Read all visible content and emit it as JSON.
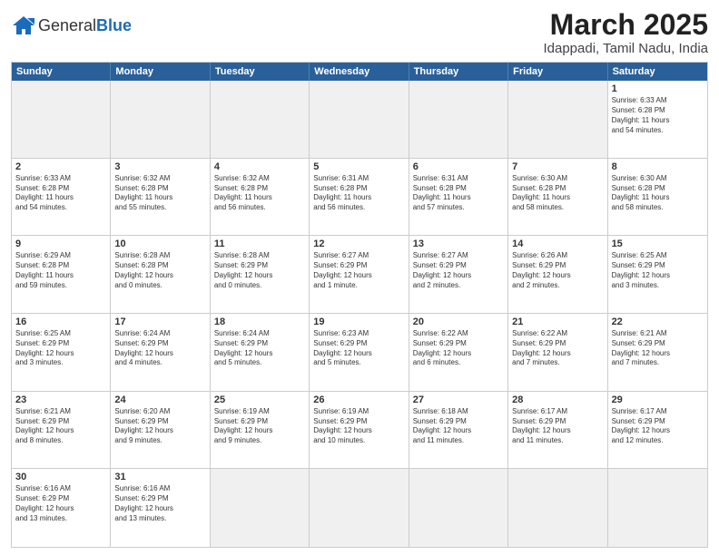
{
  "header": {
    "logo_general": "General",
    "logo_blue": "Blue",
    "month": "March 2025",
    "location": "Idappadi, Tamil Nadu, India"
  },
  "weekdays": [
    "Sunday",
    "Monday",
    "Tuesday",
    "Wednesday",
    "Thursday",
    "Friday",
    "Saturday"
  ],
  "weeks": [
    [
      {
        "day": "",
        "content": "",
        "shaded": true
      },
      {
        "day": "",
        "content": "",
        "shaded": true
      },
      {
        "day": "",
        "content": "",
        "shaded": true
      },
      {
        "day": "",
        "content": "",
        "shaded": true
      },
      {
        "day": "",
        "content": "",
        "shaded": true
      },
      {
        "day": "",
        "content": "",
        "shaded": true
      },
      {
        "day": "1",
        "content": "Sunrise: 6:33 AM\nSunset: 6:28 PM\nDaylight: 11 hours\nand 54 minutes."
      }
    ],
    [
      {
        "day": "2",
        "content": "Sunrise: 6:33 AM\nSunset: 6:28 PM\nDaylight: 11 hours\nand 54 minutes."
      },
      {
        "day": "3",
        "content": "Sunrise: 6:32 AM\nSunset: 6:28 PM\nDaylight: 11 hours\nand 55 minutes."
      },
      {
        "day": "4",
        "content": "Sunrise: 6:32 AM\nSunset: 6:28 PM\nDaylight: 11 hours\nand 56 minutes."
      },
      {
        "day": "5",
        "content": "Sunrise: 6:31 AM\nSunset: 6:28 PM\nDaylight: 11 hours\nand 56 minutes."
      },
      {
        "day": "6",
        "content": "Sunrise: 6:31 AM\nSunset: 6:28 PM\nDaylight: 11 hours\nand 57 minutes."
      },
      {
        "day": "7",
        "content": "Sunrise: 6:30 AM\nSunset: 6:28 PM\nDaylight: 11 hours\nand 58 minutes."
      },
      {
        "day": "8",
        "content": "Sunrise: 6:30 AM\nSunset: 6:28 PM\nDaylight: 11 hours\nand 58 minutes."
      }
    ],
    [
      {
        "day": "9",
        "content": "Sunrise: 6:29 AM\nSunset: 6:28 PM\nDaylight: 11 hours\nand 59 minutes."
      },
      {
        "day": "10",
        "content": "Sunrise: 6:28 AM\nSunset: 6:28 PM\nDaylight: 12 hours\nand 0 minutes."
      },
      {
        "day": "11",
        "content": "Sunrise: 6:28 AM\nSunset: 6:29 PM\nDaylight: 12 hours\nand 0 minutes."
      },
      {
        "day": "12",
        "content": "Sunrise: 6:27 AM\nSunset: 6:29 PM\nDaylight: 12 hours\nand 1 minute."
      },
      {
        "day": "13",
        "content": "Sunrise: 6:27 AM\nSunset: 6:29 PM\nDaylight: 12 hours\nand 2 minutes."
      },
      {
        "day": "14",
        "content": "Sunrise: 6:26 AM\nSunset: 6:29 PM\nDaylight: 12 hours\nand 2 minutes."
      },
      {
        "day": "15",
        "content": "Sunrise: 6:25 AM\nSunset: 6:29 PM\nDaylight: 12 hours\nand 3 minutes."
      }
    ],
    [
      {
        "day": "16",
        "content": "Sunrise: 6:25 AM\nSunset: 6:29 PM\nDaylight: 12 hours\nand 3 minutes."
      },
      {
        "day": "17",
        "content": "Sunrise: 6:24 AM\nSunset: 6:29 PM\nDaylight: 12 hours\nand 4 minutes."
      },
      {
        "day": "18",
        "content": "Sunrise: 6:24 AM\nSunset: 6:29 PM\nDaylight: 12 hours\nand 5 minutes."
      },
      {
        "day": "19",
        "content": "Sunrise: 6:23 AM\nSunset: 6:29 PM\nDaylight: 12 hours\nand 5 minutes."
      },
      {
        "day": "20",
        "content": "Sunrise: 6:22 AM\nSunset: 6:29 PM\nDaylight: 12 hours\nand 6 minutes."
      },
      {
        "day": "21",
        "content": "Sunrise: 6:22 AM\nSunset: 6:29 PM\nDaylight: 12 hours\nand 7 minutes."
      },
      {
        "day": "22",
        "content": "Sunrise: 6:21 AM\nSunset: 6:29 PM\nDaylight: 12 hours\nand 7 minutes."
      }
    ],
    [
      {
        "day": "23",
        "content": "Sunrise: 6:21 AM\nSunset: 6:29 PM\nDaylight: 12 hours\nand 8 minutes."
      },
      {
        "day": "24",
        "content": "Sunrise: 6:20 AM\nSunset: 6:29 PM\nDaylight: 12 hours\nand 9 minutes."
      },
      {
        "day": "25",
        "content": "Sunrise: 6:19 AM\nSunset: 6:29 PM\nDaylight: 12 hours\nand 9 minutes."
      },
      {
        "day": "26",
        "content": "Sunrise: 6:19 AM\nSunset: 6:29 PM\nDaylight: 12 hours\nand 10 minutes."
      },
      {
        "day": "27",
        "content": "Sunrise: 6:18 AM\nSunset: 6:29 PM\nDaylight: 12 hours\nand 11 minutes."
      },
      {
        "day": "28",
        "content": "Sunrise: 6:17 AM\nSunset: 6:29 PM\nDaylight: 12 hours\nand 11 minutes."
      },
      {
        "day": "29",
        "content": "Sunrise: 6:17 AM\nSunset: 6:29 PM\nDaylight: 12 hours\nand 12 minutes."
      }
    ],
    [
      {
        "day": "30",
        "content": "Sunrise: 6:16 AM\nSunset: 6:29 PM\nDaylight: 12 hours\nand 13 minutes."
      },
      {
        "day": "31",
        "content": "Sunrise: 6:16 AM\nSunset: 6:29 PM\nDaylight: 12 hours\nand 13 minutes."
      },
      {
        "day": "",
        "content": "",
        "shaded": true
      },
      {
        "day": "",
        "content": "",
        "shaded": true
      },
      {
        "day": "",
        "content": "",
        "shaded": true
      },
      {
        "day": "",
        "content": "",
        "shaded": true
      },
      {
        "day": "",
        "content": "",
        "shaded": true
      }
    ]
  ]
}
